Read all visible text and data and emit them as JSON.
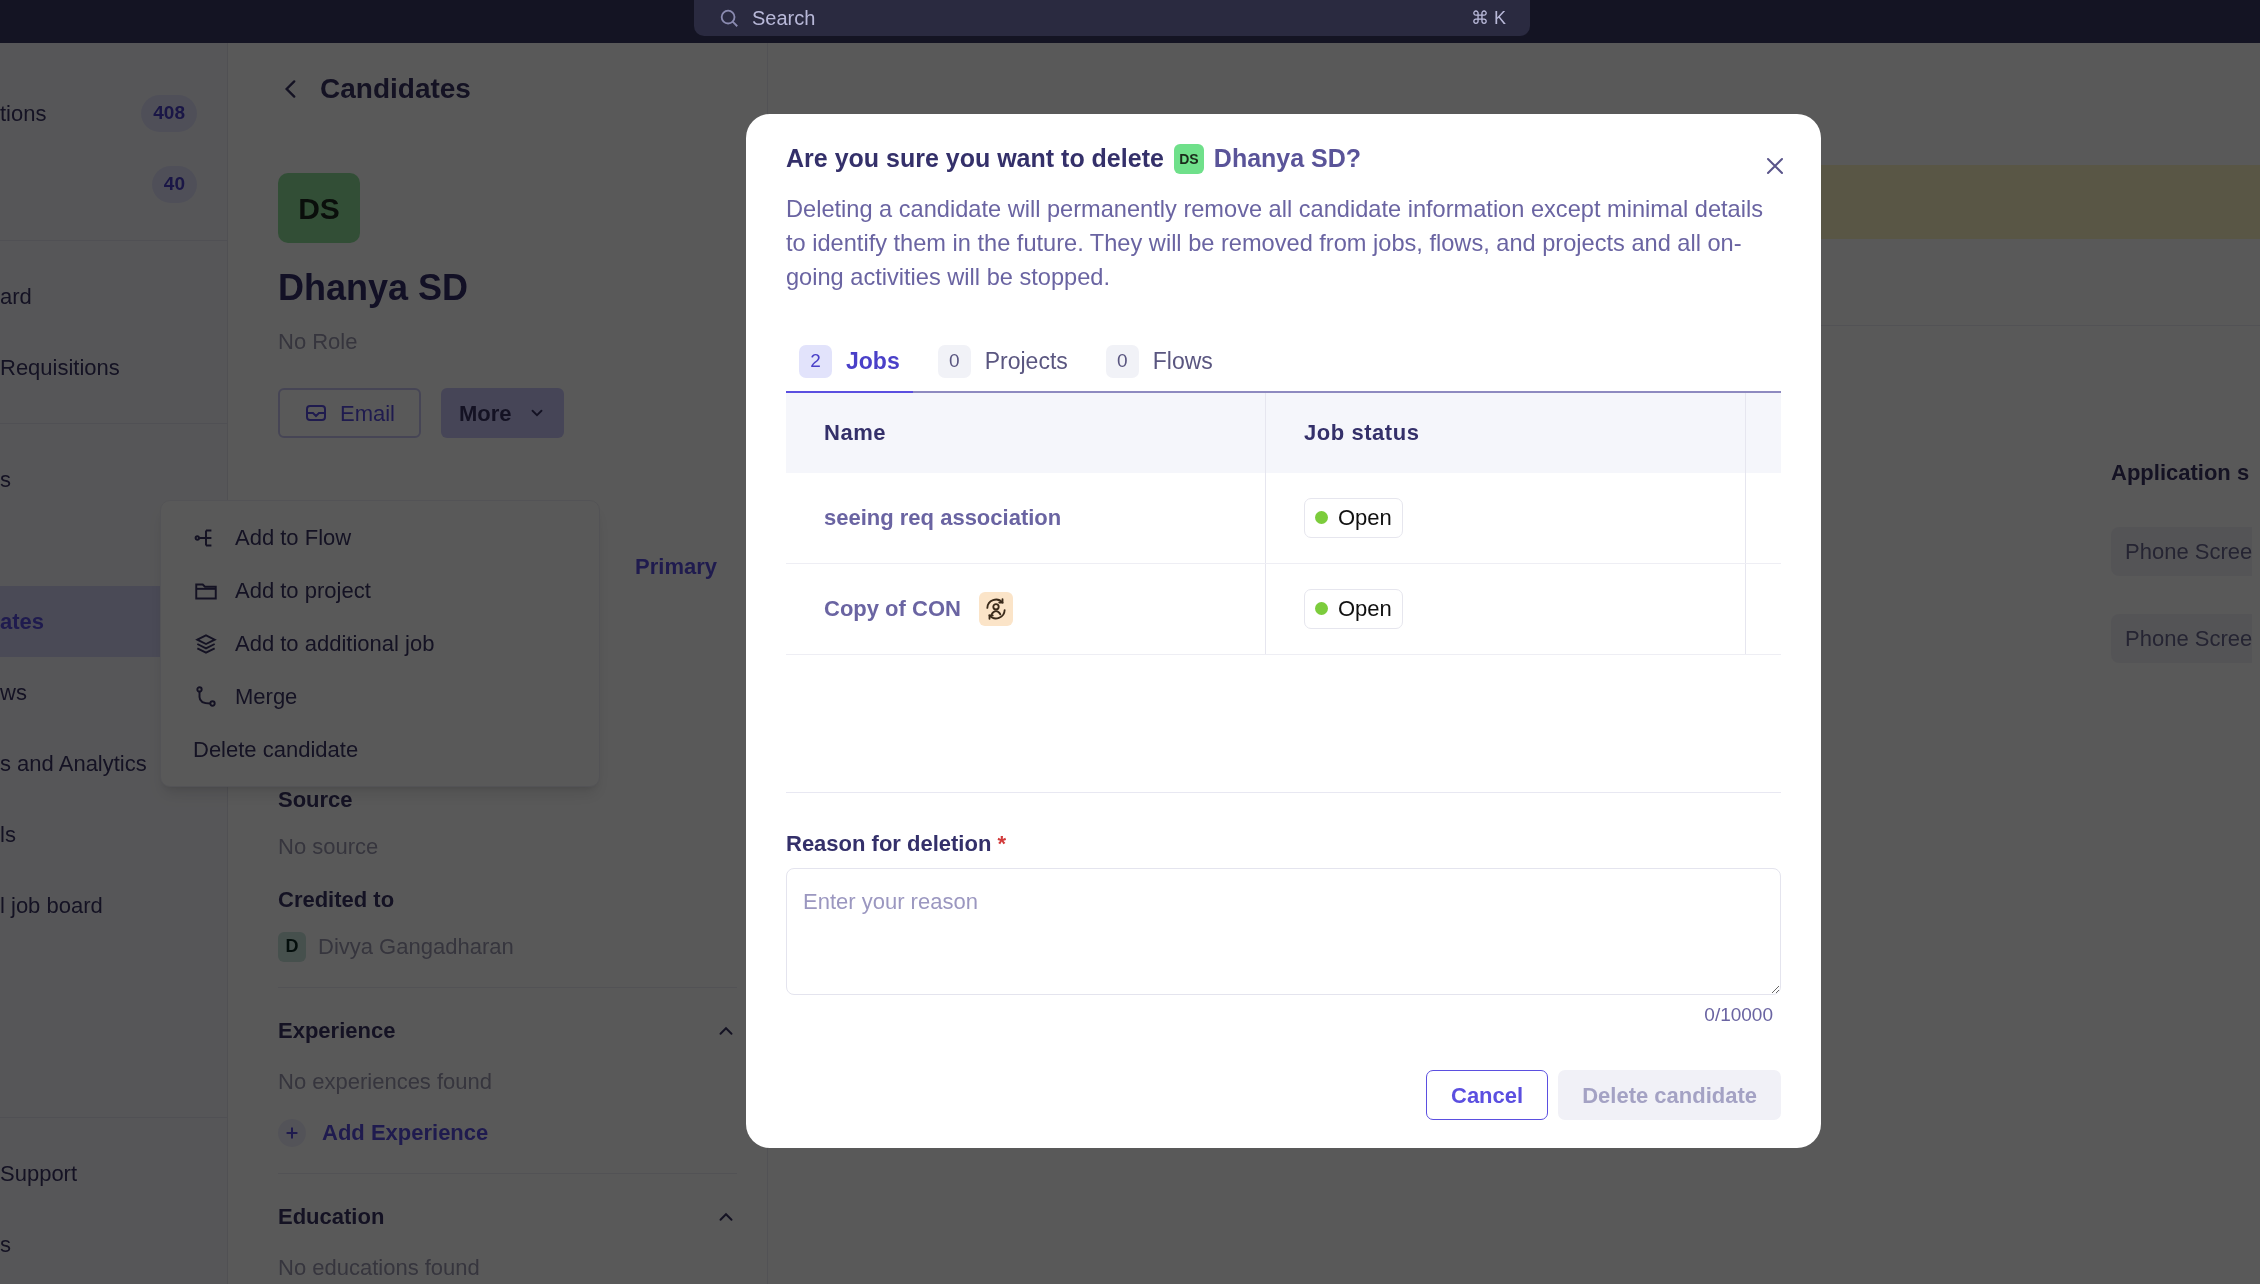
{
  "top_bar": {
    "search": {
      "placeholder": "Search",
      "shortcut": "⌘ K"
    }
  },
  "sidebar": {
    "sections": [
      {
        "items": [
          {
            "label": "tions",
            "count": "408",
            "selected": false
          },
          {
            "count": "40",
            "selected": false
          }
        ]
      },
      {
        "items": [
          {
            "label": "ard",
            "selected": false
          },
          {
            "label": "Requisitions",
            "selected": false
          }
        ]
      },
      {
        "items": [
          {
            "label": "s",
            "selected": false
          },
          {
            "label": "ates",
            "selected": true
          },
          {
            "label": "ws",
            "selected": false
          },
          {
            "label": "s and Analytics",
            "selected": false
          },
          {
            "label": "ls",
            "selected": false
          },
          {
            "label": "l job board",
            "selected": false
          }
        ]
      },
      {
        "items": [
          {
            "label": "Support",
            "selected": false
          },
          {
            "label": "s",
            "selected": false
          }
        ]
      }
    ]
  },
  "header": {
    "back_title": "Candidates"
  },
  "profile": {
    "initials": "DS",
    "name": "Dhanya SD",
    "role": "No Role",
    "buttons": [
      "Email",
      "More"
    ],
    "primary_tag": "Primary",
    "fields": [
      {
        "label": "Source",
        "value": "No source"
      },
      {
        "label": "Credited to",
        "value": "Divya Gangadharan",
        "avatar": "D"
      }
    ],
    "sections": [
      {
        "title": "Experience",
        "empty": "No experiences found",
        "action": "Add Experience"
      },
      {
        "title": "Education",
        "empty": "No educations found"
      }
    ]
  },
  "more_menu": {
    "items": [
      {
        "label": "Add to Flow",
        "kind": "flow"
      },
      {
        "label": "Add to project",
        "kind": "folder"
      },
      {
        "label": "Add to additional job",
        "kind": "stack"
      },
      {
        "label": "Merge",
        "kind": "merge"
      },
      {
        "label": "Delete candidate",
        "kind": "plain"
      }
    ]
  },
  "right_panel": {
    "heading": "Application s",
    "chips": [
      "Phone Scree",
      "Phone Scree"
    ]
  },
  "dialog": {
    "title": "Are you sure you want to delete",
    "candidate_initials": "DS",
    "candidate_name": "Dhanya SD?",
    "description": "Deleting a candidate will permanently remove all candidate information except minimal details to identify them in the future. They will be removed from jobs, flows, and projects and all on-going activities will be stopped.",
    "tabs": [
      {
        "count": "2",
        "label": "Jobs",
        "selected": true
      },
      {
        "count": "0",
        "label": "Projects",
        "selected": false
      },
      {
        "count": "0",
        "label": "Flows",
        "selected": false
      }
    ],
    "table": {
      "columns": [
        "Name",
        "Job status"
      ],
      "rows": [
        {
          "name": "seeing req association",
          "flagged": false,
          "status": "Open",
          "color": "#7ccc3c"
        },
        {
          "name": "Copy of CON",
          "flagged": true,
          "status": "Open",
          "color": "#7ccc3c"
        }
      ]
    },
    "reason": {
      "label": "Reason for deletion",
      "required_mark": "*",
      "placeholder": "Enter your reason",
      "counter": "0/10000"
    },
    "buttons": [
      {
        "label": "Cancel",
        "kind": "secondary"
      },
      {
        "label": "Delete candidate",
        "kind": "danger",
        "disabled": true
      }
    ]
  }
}
